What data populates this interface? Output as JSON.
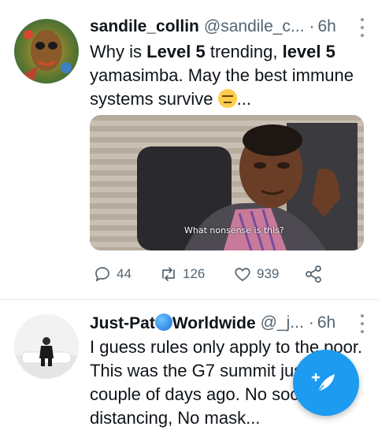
{
  "tweets": [
    {
      "display_name": "sandile_collin",
      "handle": "@sandile_c...",
      "separator": "·",
      "time": "6h",
      "text_segments": [
        "Why is ",
        "Level 5",
        " trending, ",
        "level 5",
        " yamasimba. May the best immune systems survive ",
        "..."
      ],
      "emoji": "expressionless-face-emoji",
      "media_caption": "What nonsense is this?",
      "actions": {
        "replies": "44",
        "retweets": "126",
        "likes": "939"
      }
    },
    {
      "display_name_prefix": "Just-Pat",
      "display_name_suffix": "Worldwide",
      "handle": "@_j...",
      "separator": "·",
      "time": "6h",
      "text": "I guess rules only apply to the poor. This was the G7 summit just a couple of days ago. No social distancing, No mask..."
    }
  ],
  "colors": {
    "accent": "#1d9bf0",
    "secondary_text": "#536471",
    "divider": "#e1e8ed"
  },
  "icons": [
    "reply-icon",
    "retweet-icon",
    "like-icon",
    "share-icon",
    "more-icon",
    "compose-tweet-icon",
    "globe-emoji"
  ]
}
